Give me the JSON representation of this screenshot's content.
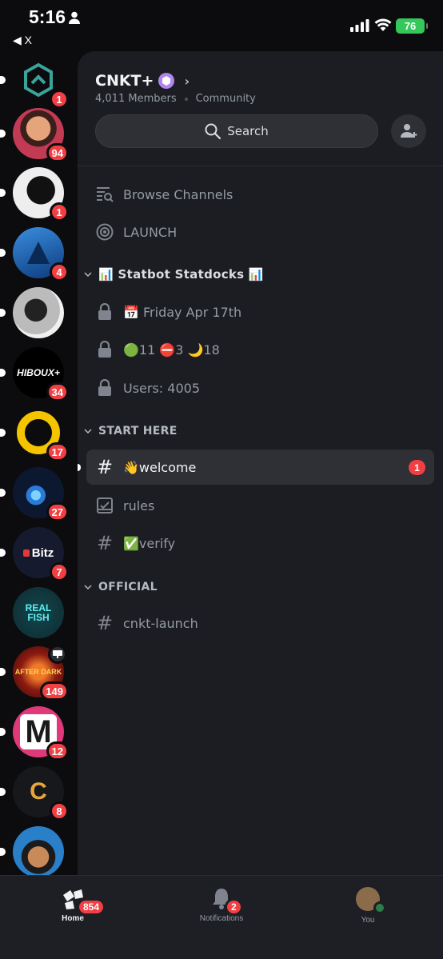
{
  "status_bar": {
    "time": "5:16",
    "back_label": "◀ X",
    "battery": "76"
  },
  "guilds": [
    {
      "name": "guild-1",
      "badge": "1",
      "bg": "#1b3b36"
    },
    {
      "name": "guild-2",
      "badge": "94",
      "bg": "#c23a54"
    },
    {
      "name": "guild-3",
      "badge": "1",
      "bg": "#e9e9e9"
    },
    {
      "name": "guild-4",
      "badge": "4",
      "bg": "#1f5fa8"
    },
    {
      "name": "guild-5",
      "badge": "",
      "bg": "#d9d9d9"
    },
    {
      "name": "guild-hiboux",
      "text": "HIBOUX+",
      "badge": "34",
      "bg": "#000000"
    },
    {
      "name": "guild-7",
      "badge": "17",
      "bg": "#1a1a1a"
    },
    {
      "name": "guild-8",
      "badge": "27",
      "bg": "#0b1830"
    },
    {
      "name": "guild-bitz",
      "text": "Bitz",
      "badge": "7",
      "bg": "#161a2e"
    },
    {
      "name": "guild-realfish",
      "text": "REAL FISH",
      "badge": "",
      "bg": "#0d2a2e"
    },
    {
      "name": "guild-afterdark",
      "text": "AFTER DARK",
      "badge": "149",
      "bg": "#6b1410"
    },
    {
      "name": "guild-m",
      "text": "M",
      "badge": "12",
      "bg": "#e0397a"
    },
    {
      "name": "guild-c",
      "text": "C",
      "badge": "8",
      "bg": "#17181c"
    },
    {
      "name": "guild-14",
      "badge": "",
      "bg": "#2a7fc9"
    }
  ],
  "server": {
    "name": "CNKT+",
    "members": "4,011 Members",
    "type": "Community",
    "search_label": "Search"
  },
  "top_items": [
    {
      "label": "Browse Channels"
    },
    {
      "label": "LAUNCH"
    }
  ],
  "categories": {
    "statbot": "📊 Statbot Statdocks 📊",
    "start_here": "START HERE",
    "official": "OFFICIAL"
  },
  "statbot_channels": [
    "📅 Friday Apr 17th",
    "🟢11 ⛔3 🌙18",
    "Users: 4005"
  ],
  "start_channels": [
    {
      "label": "👋welcome",
      "badge": "1"
    },
    {
      "label": "rules"
    },
    {
      "label": "✅verify"
    }
  ],
  "official_channels": [
    "cnkt-launch"
  ],
  "tabbar": {
    "home_label": "Home",
    "home_badge": "854",
    "notifications_label": "Notifications",
    "notifications_badge": "2",
    "you_label": "You"
  },
  "colors": {
    "accent_red": "#f23f43",
    "boost": "#b185f0",
    "online": "#2d7d46"
  }
}
